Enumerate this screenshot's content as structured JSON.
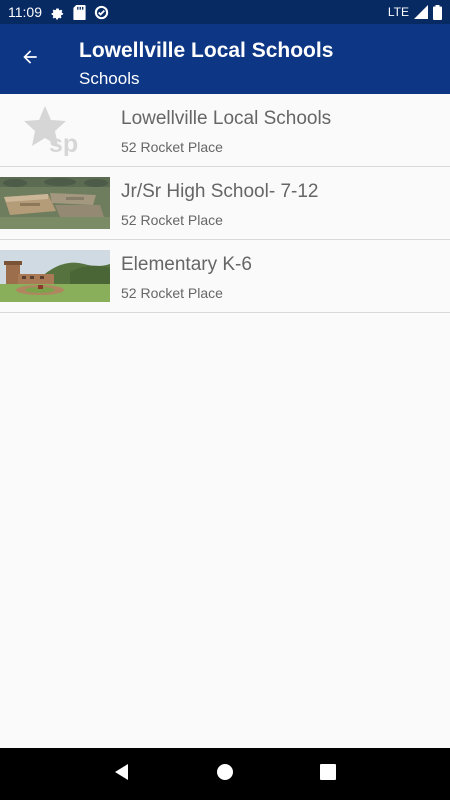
{
  "status_bar": {
    "time": "11:09",
    "network": "LTE",
    "icons": [
      "gear-icon",
      "sd-card-icon",
      "data-saver-icon",
      "signal-icon",
      "battery-icon"
    ]
  },
  "app_bar": {
    "back_icon": "arrow-back-icon",
    "title": "Lowellville Local Schools",
    "subtitle": "Schools",
    "background_color": "#0d3785"
  },
  "schools": [
    {
      "name": "Lowellville Local Schools",
      "address": "52 Rocket Place",
      "thumbnail": "sp-star-logo"
    },
    {
      "name": "Jr/Sr High School- 7-12",
      "address": "52 Rocket Place",
      "thumbnail": "aerial-building-photo"
    },
    {
      "name": "Elementary K-6",
      "address": "52 Rocket Place",
      "thumbnail": "school-front-photo"
    }
  ],
  "nav_bar": {
    "icons": [
      "back-triangle-icon",
      "home-circle-icon",
      "recents-square-icon"
    ]
  }
}
